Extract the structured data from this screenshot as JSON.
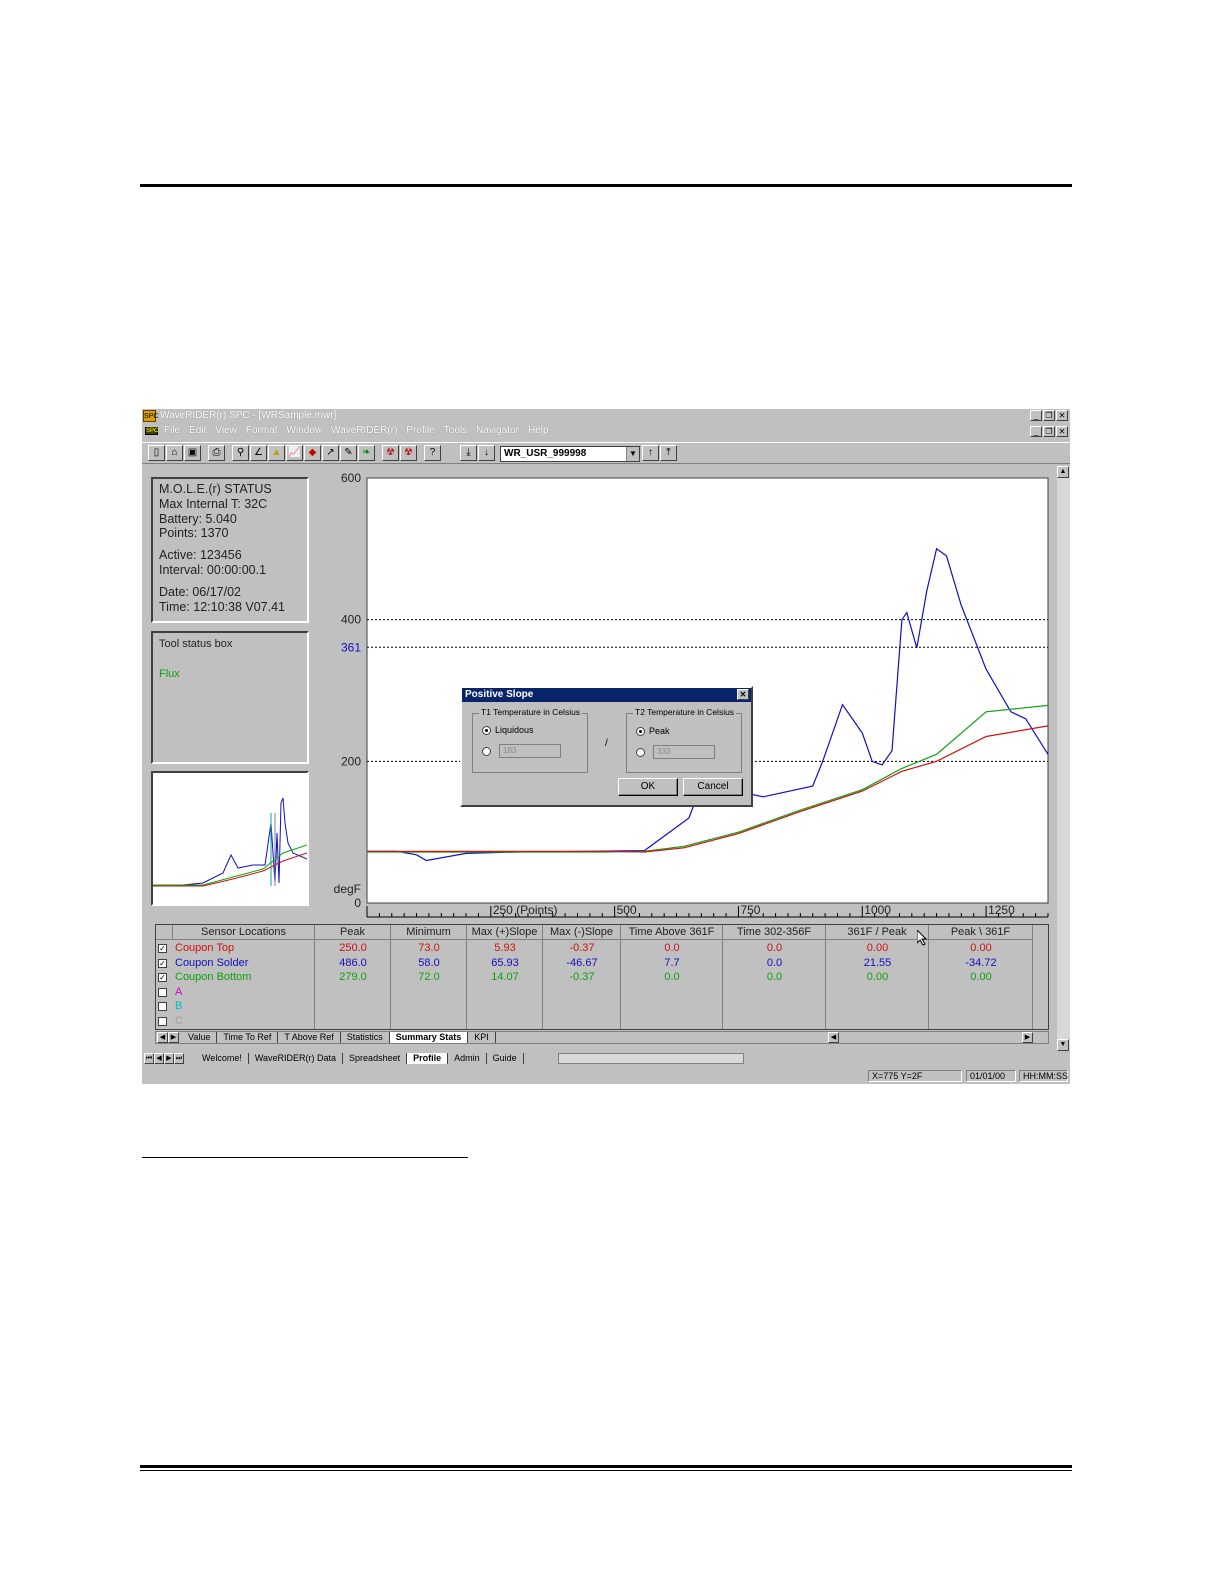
{
  "window": {
    "title": "WaveRIDER(r) SPC - [WRSample.mwr]",
    "menu": [
      "File",
      "Edit",
      "View",
      "Format",
      "Window",
      "WaveRIDER(r)",
      "Profile",
      "Tools",
      "Navigator",
      "Help"
    ]
  },
  "toolbar": {
    "user_combo_value": "WR_USR_999998"
  },
  "status_panel": {
    "title": "M.O.L.E.(r) STATUS",
    "max_internal": "Max Internal T: 32C",
    "battery": "Battery: 5.040",
    "points": "Points: 1370",
    "active": "Active: 123456",
    "interval": "Interval: 00:00:00.1",
    "date": "Date: 06/17/02",
    "time": "Time: 12:10:38   V07.41"
  },
  "tool_status": {
    "title": "Tool status box",
    "item": "Flux"
  },
  "chart_data": {
    "type": "line",
    "ylabel": "degF",
    "xlabel": "250 (Points)",
    "ylim": [
      0,
      600
    ],
    "xlim": [
      0,
      1375
    ],
    "y_ticks": [
      0,
      200,
      400,
      600
    ],
    "x_ticks": [
      "250 (Points)",
      "500",
      "750",
      "1000",
      "1250"
    ],
    "reference_lines": [
      {
        "value": 400,
        "label": "400"
      },
      {
        "value": 361,
        "label": "361"
      },
      {
        "value": 200,
        "label": "200"
      }
    ],
    "colors": {
      "top": "#d01010",
      "solder": "#1010c0",
      "bottom": "#10a010"
    },
    "series": [
      {
        "key": "solder",
        "color": "#1010c0",
        "x": [
          0,
          60,
          100,
          120,
          200,
          300,
          450,
          560,
          650,
          710,
          730,
          800,
          900,
          920,
          960,
          1000,
          1020,
          1040,
          1060,
          1080,
          1090,
          1110,
          1130,
          1150,
          1170,
          1200,
          1250,
          1300,
          1330,
          1375
        ],
        "y": [
          73,
          73,
          68,
          60,
          70,
          72,
          73,
          74,
          120,
          230,
          160,
          150,
          165,
          200,
          280,
          240,
          200,
          195,
          215,
          400,
          410,
          360,
          440,
          500,
          490,
          420,
          330,
          270,
          260,
          210
        ]
      },
      {
        "key": "bottom",
        "color": "#10a010",
        "x": [
          0,
          100,
          300,
          480,
          560,
          640,
          750,
          870,
          1000,
          1080,
          1150,
          1250,
          1375
        ],
        "y": [
          72,
          72,
          72,
          72,
          73,
          80,
          100,
          130,
          160,
          190,
          210,
          270,
          279
        ]
      },
      {
        "key": "top",
        "color": "#d01010",
        "x": [
          0,
          100,
          300,
          480,
          560,
          640,
          750,
          870,
          1000,
          1080,
          1150,
          1250,
          1375
        ],
        "y": [
          73,
          73,
          73,
          73,
          72,
          78,
          98,
          128,
          158,
          186,
          200,
          235,
          250
        ]
      }
    ]
  },
  "grid": {
    "headers": [
      "Sensor Locations",
      "Peak",
      "Minimum",
      "Max (+)Slope",
      "Max (-)Slope",
      "Time Above 361F",
      "Time 302-356F",
      "361F / Peak",
      "Peak \\ 361F"
    ],
    "rows": [
      {
        "name": "Coupon Top",
        "color": "#d01010",
        "checked": true,
        "values": [
          "250.0",
          "73.0",
          "5.93",
          "-0.37",
          "0.0",
          "0.0",
          "0.00",
          "0.00"
        ]
      },
      {
        "name": "Coupon Solder",
        "color": "#1010c0",
        "checked": true,
        "values": [
          "486.0",
          "58.0",
          "65.93",
          "-46.67",
          "7.7",
          "0.0",
          "21.55",
          "-34.72"
        ]
      },
      {
        "name": "Coupon Bottom",
        "color": "#10a010",
        "checked": true,
        "values": [
          "279.0",
          "72.0",
          "14.07",
          "-0.37",
          "0.0",
          "0.0",
          "0.00",
          "0.00"
        ]
      },
      {
        "name": "A",
        "color": "#d000d0",
        "checked": false,
        "values": [
          "",
          "",
          "",
          "",
          "",
          "",
          "",
          ""
        ]
      },
      {
        "name": "B",
        "color": "#00c0c0",
        "checked": false,
        "values": [
          "",
          "",
          "",
          "",
          "",
          "",
          "",
          ""
        ]
      },
      {
        "name": "C",
        "color": "#a0a0a0",
        "checked": false,
        "values": [
          "",
          "",
          "",
          "",
          "",
          "",
          "",
          ""
        ]
      }
    ]
  },
  "inner_tabs": [
    "Value",
    "Time To Ref",
    "T Above Ref",
    "Statistics",
    "Summary Stats",
    "KPI"
  ],
  "inner_tab_active": "Summary Stats",
  "outer_tabs": [
    "Welcome!",
    "WaveRIDER(r) Data",
    "Spreadsheet",
    "Profile",
    "Admin",
    "Guide"
  ],
  "outer_tab_active": "Profile",
  "statusbar": {
    "coords": "X=775 Y=2F",
    "date": "01/01/00",
    "time": "HH:MM:SS"
  },
  "dialog": {
    "title": "Positive Slope",
    "t1_group": "T1 Temperature in Celsius",
    "t1_option": "Liquidous",
    "t1_value": "183",
    "separator": "/",
    "t2_group": "T2 Temperature in Celsius",
    "t2_option": "Peak",
    "t2_value": "333",
    "ok": "OK",
    "cancel": "Cancel"
  }
}
